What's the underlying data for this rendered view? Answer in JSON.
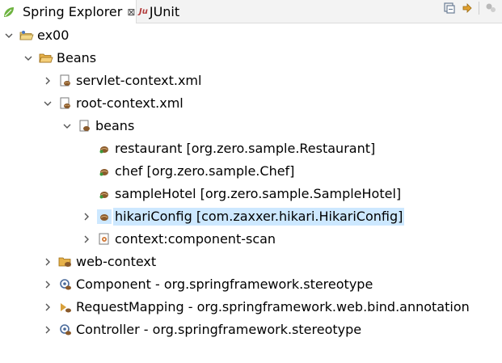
{
  "tabs": {
    "spring_explorer": "Spring Explorer",
    "close_glyph": "⊠",
    "junit": "JUnit",
    "junit_icon_text": "Ju"
  },
  "tree": {
    "project": "ex00",
    "beans_folder": "Beans",
    "servlet_context": "servlet-context.xml",
    "root_context": "root-context.xml",
    "beans_node": "beans",
    "bean_restaurant": "restaurant [org.zero.sample.Restaurant]",
    "bean_chef": "chef [org.zero.sample.Chef]",
    "bean_samplehotel": "sampleHotel [org.zero.sample.SampleHotel]",
    "bean_hikari": "hikariConfig [com.zaxxer.hikari.HikariConfig]",
    "component_scan": "context:component-scan",
    "web_context": "web-context",
    "annotation_component": "Component - org.springframework.stereotype",
    "annotation_requestmapping": "RequestMapping - org.springframework.web.bind.annotation",
    "annotation_controller": "Controller - org.springframework.stereotype"
  },
  "colors": {
    "selection": "#cde8ff",
    "bean_icon": "#8a5a2b",
    "folder_icon": "#e7b24a",
    "spring_green": "#6db33f"
  }
}
